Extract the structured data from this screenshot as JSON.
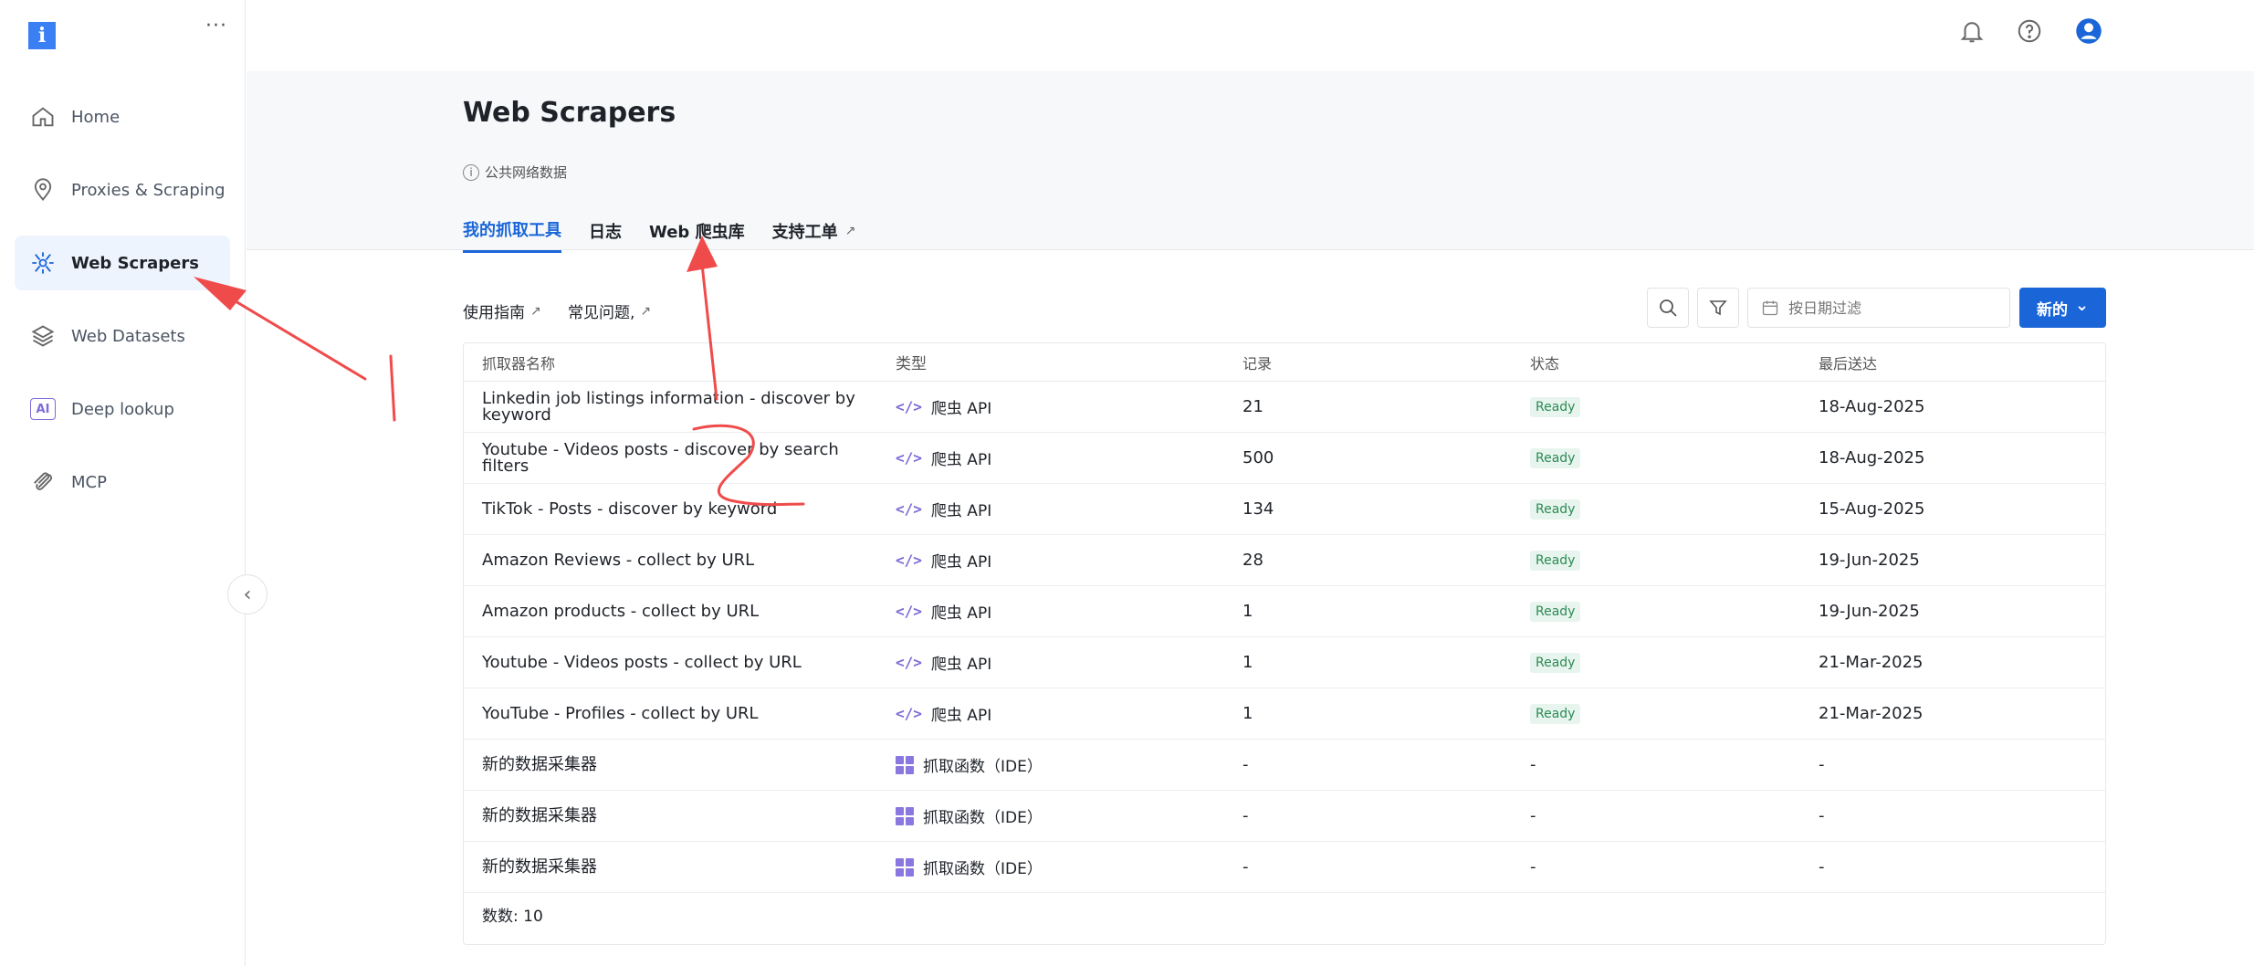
{
  "sidebar": {
    "logo": "i",
    "more": "···",
    "items": [
      {
        "label": "Home",
        "icon": "home-icon"
      },
      {
        "label": "Proxies & Scraping",
        "icon": "location-pin-icon"
      },
      {
        "label": "Web Scrapers",
        "icon": "scraper-spider-icon",
        "active": true
      },
      {
        "label": "Web Datasets",
        "icon": "layers-icon"
      },
      {
        "label": "Deep lookup",
        "icon": "ai-icon"
      },
      {
        "label": "MCP",
        "icon": "mcp-icon"
      }
    ],
    "ai_badge": "AI",
    "collapse_glyph": "‹"
  },
  "topbar": {
    "icons": [
      "bell-icon",
      "help-icon",
      "user-avatar-icon"
    ],
    "accent": "#1a66d8"
  },
  "header": {
    "title": "Web Scrapers",
    "info_glyph": "i",
    "info_text": "公共网络数据",
    "tabs": [
      {
        "label": "我的抓取工具",
        "active": true
      },
      {
        "label": "日志"
      },
      {
        "label": "Web 爬虫库"
      },
      {
        "label": "支持工单",
        "external": true
      }
    ],
    "ext_glyph": "↗"
  },
  "toolbar": {
    "guide_label": "使用指南",
    "faq_label": "常见问题,",
    "ext_glyph": "↗",
    "date_placeholder": "按日期过滤",
    "new_label": "新的",
    "new_caret": "⌄"
  },
  "table": {
    "headers": [
      "抓取器名称",
      "类型",
      "记录",
      "状态",
      "最后送达"
    ],
    "rows": [
      {
        "name": "Linkedin job listings information - discover by keyword",
        "type": "爬虫 API",
        "type_icon": "code",
        "records": "21",
        "status": "Ready",
        "delivered": "18-Aug-2025"
      },
      {
        "name": "Youtube - Videos posts - discover by search filters",
        "type": "爬虫 API",
        "type_icon": "code",
        "records": "500",
        "status": "Ready",
        "delivered": "18-Aug-2025"
      },
      {
        "name": "TikTok - Posts - discover by keyword",
        "type": "爬虫 API",
        "type_icon": "code",
        "records": "134",
        "status": "Ready",
        "delivered": "15-Aug-2025"
      },
      {
        "name": "Amazon Reviews - collect by URL",
        "type": "爬虫 API",
        "type_icon": "code",
        "records": "28",
        "status": "Ready",
        "delivered": "19-Jun-2025"
      },
      {
        "name": "Amazon products - collect by URL",
        "type": "爬虫 API",
        "type_icon": "code",
        "records": "1",
        "status": "Ready",
        "delivered": "19-Jun-2025"
      },
      {
        "name": "Youtube - Videos posts - collect by URL",
        "type": "爬虫 API",
        "type_icon": "code",
        "records": "1",
        "status": "Ready",
        "delivered": "21-Mar-2025"
      },
      {
        "name": "YouTube - Profiles - collect by URL",
        "type": "爬虫 API",
        "type_icon": "code",
        "records": "1",
        "status": "Ready",
        "delivered": "21-Mar-2025"
      },
      {
        "name": "新的数据采集器",
        "type": "抓取函数（IDE）",
        "type_icon": "grid",
        "records": "-",
        "status": "-",
        "delivered": "-"
      },
      {
        "name": "新的数据采集器",
        "type": "抓取函数（IDE）",
        "type_icon": "grid",
        "records": "-",
        "status": "-",
        "delivered": "-"
      },
      {
        "name": "新的数据采集器",
        "type": "抓取函数（IDE）",
        "type_icon": "grid",
        "records": "-",
        "status": "-",
        "delivered": "-"
      }
    ],
    "count_label": "数数: 10"
  },
  "colors": {
    "accent": "#1a66d8",
    "ready_bg": "#e8f5ee",
    "ready_text": "#2c8a55",
    "annotation": "#f04b4b"
  }
}
